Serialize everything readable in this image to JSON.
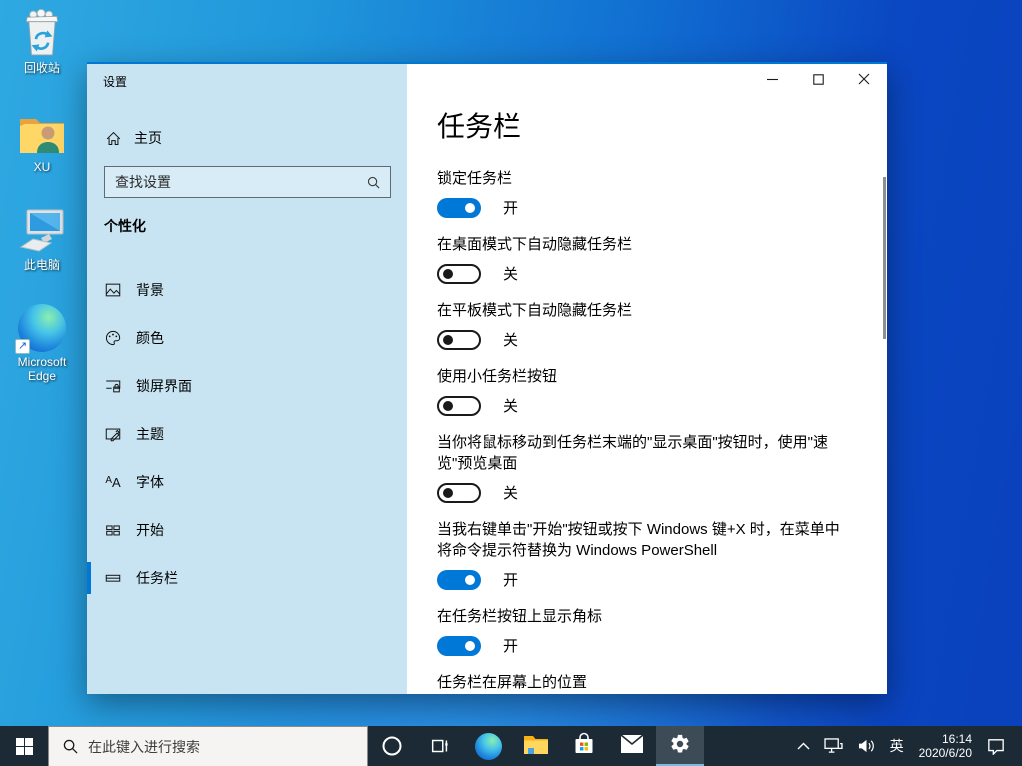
{
  "desktop": {
    "icons": [
      {
        "label": "回收站"
      },
      {
        "label": "XU"
      },
      {
        "label": "此电脑"
      },
      {
        "label": "Microsoft Edge"
      }
    ]
  },
  "settings_window": {
    "title": "设置",
    "sidebar": {
      "home_label": "主页",
      "search_placeholder": "查找设置",
      "section_header": "个性化",
      "items": [
        {
          "label": "背景"
        },
        {
          "label": "颜色"
        },
        {
          "label": "锁屏界面"
        },
        {
          "label": "主题"
        },
        {
          "label": "字体"
        },
        {
          "label": "开始"
        },
        {
          "label": "任务栏"
        }
      ]
    },
    "main": {
      "page_title": "任务栏",
      "settings": [
        {
          "label": "锁定任务栏",
          "state": "开"
        },
        {
          "label": "在桌面模式下自动隐藏任务栏",
          "state": "关"
        },
        {
          "label": "在平板模式下自动隐藏任务栏",
          "state": "关"
        },
        {
          "label": "使用小任务栏按钮",
          "state": "关"
        },
        {
          "label": "当你将鼠标移动到任务栏末端的\"显示桌面\"按钮时，使用\"速览\"预览桌面",
          "state": "关"
        },
        {
          "label": "当我右键单击\"开始\"按钮或按下 Windows 键+X 时，在菜单中将命令提示符替换为 Windows PowerShell",
          "state": "开"
        },
        {
          "label": "在任务栏按钮上显示角标",
          "state": "开"
        }
      ],
      "position_label": "任务栏在屏幕上的位置"
    }
  },
  "taskbar": {
    "search_placeholder": "在此键入进行搜索",
    "ime_indicator": "英",
    "clock": {
      "time": "16:14",
      "date": "2020/6/20"
    }
  },
  "colors": {
    "accent": "#0078D7",
    "sidebar_bg": "#C8E4F2",
    "taskbar_bg": "#1B2A35",
    "active_app_bg": "#3C4B55",
    "active_app_underline": "#7AB8E8"
  }
}
